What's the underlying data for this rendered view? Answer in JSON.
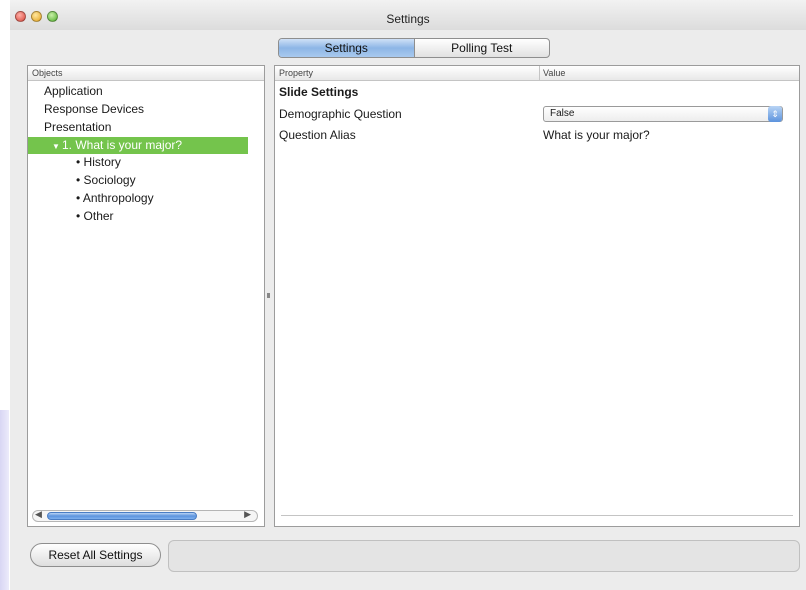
{
  "window": {
    "title": "Settings"
  },
  "tabs": [
    {
      "label": "Settings",
      "active": true
    },
    {
      "label": "Polling Test",
      "active": false
    }
  ],
  "objects_panel": {
    "header": "Objects",
    "items": [
      {
        "label": "Application",
        "level": 0
      },
      {
        "label": "Response Devices",
        "level": 0
      },
      {
        "label": "Presentation",
        "level": 0
      },
      {
        "label": "1. What is your major?",
        "level": 1,
        "selected": true,
        "expanded": true
      },
      {
        "label": "• History",
        "level": 2
      },
      {
        "label": "• Sociology",
        "level": 2
      },
      {
        "label": "• Anthropology",
        "level": 2
      },
      {
        "label": "• Other",
        "level": 2
      }
    ]
  },
  "properties_panel": {
    "header_property": "Property",
    "header_value": "Value",
    "section_title": "Slide Settings",
    "rows": [
      {
        "property": "Demographic Question",
        "value": "False",
        "control": "select"
      },
      {
        "property": "Question Alias",
        "value": "What is your major?",
        "control": "text"
      }
    ]
  },
  "footer": {
    "reset_label": "Reset All Settings"
  },
  "colors": {
    "selection": "#74c44c",
    "accent": "#5c93dd"
  },
  "icons": {
    "expand": "triangle-down-icon",
    "stepper": "stepper-icon"
  }
}
